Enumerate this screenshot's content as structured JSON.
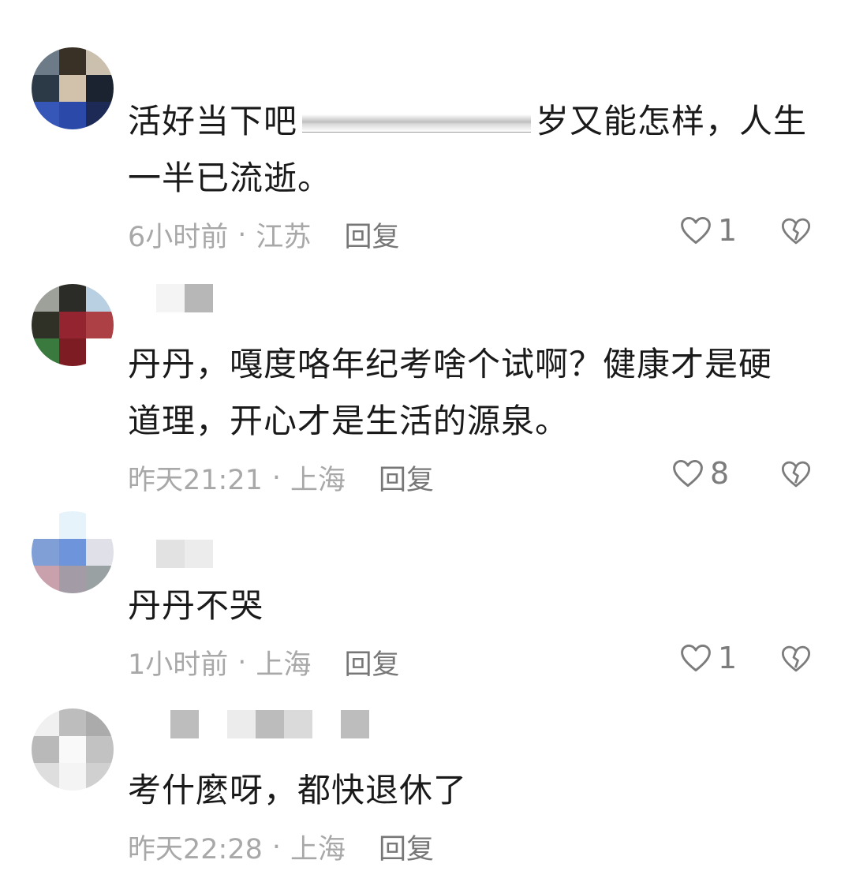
{
  "comments": [
    {
      "text_line1_before": "活好当下吧",
      "text_line1_after": "岁又能怎样，人生",
      "text_line2": "一半已流逝。",
      "time": "6小时前",
      "location": "江苏",
      "reply_label": "回复",
      "like_count": "1"
    },
    {
      "text_line1": "丹丹，嘎度咯年纪考啥个试啊？健康才是硬",
      "text_line2": "道理，开心才是生活的源泉。",
      "time": "昨天21:21",
      "location": "上海",
      "reply_label": "回复",
      "like_count": "8"
    },
    {
      "text_line1": "丹丹不哭",
      "time": "1小时前",
      "location": "上海",
      "reply_label": "回复",
      "like_count": "1"
    },
    {
      "text_line1": "考什麼呀，都快退休了",
      "time": "昨天22:28",
      "location": "上海",
      "reply_label": "回复"
    }
  ],
  "separator": "·",
  "icons": {
    "like": "heart-outline-icon",
    "dislike": "broken-heart-icon"
  },
  "colors": {
    "text": "#1a1a1a",
    "meta": "#a8a8a8",
    "reply": "#777777",
    "icon": "#7c7c7c"
  }
}
